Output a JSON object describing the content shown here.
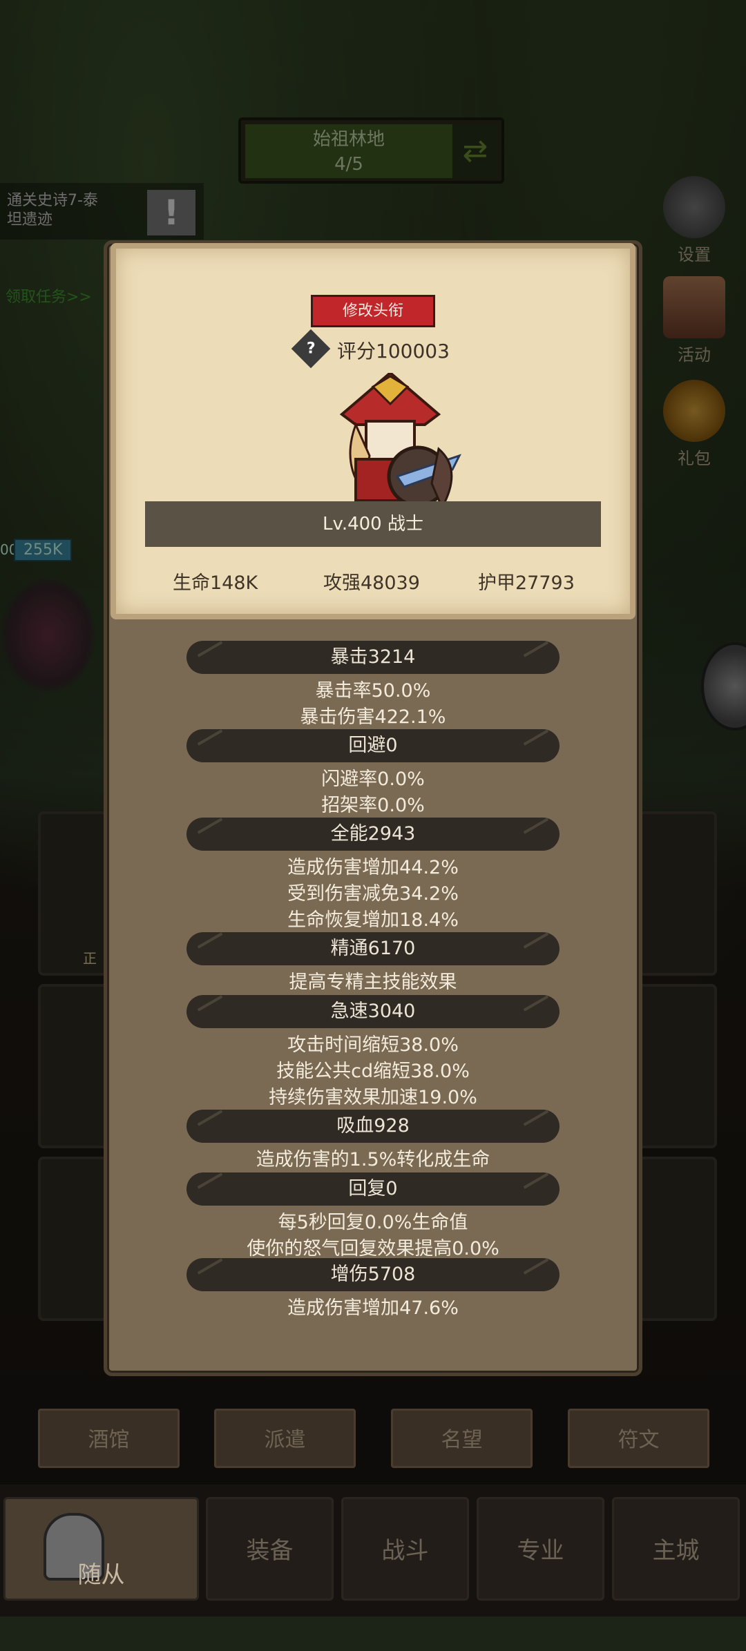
{
  "map": {
    "name": "始祖林地",
    "progress": "4/5"
  },
  "quest": {
    "text_line1": "通关史诗7-泰",
    "text_line2": "坦遗迹",
    "claim_link": "领取任务>>"
  },
  "side_buttons": {
    "settings": "设置",
    "events": "活动",
    "gift": "礼包"
  },
  "left_hp": "255K",
  "left_num": "00",
  "hero_slot_labels": {
    "status": "正"
  },
  "mid_tabs": [
    "酒馆",
    "派遣",
    "名望",
    "符文"
  ],
  "bottom_nav": [
    "随从",
    "装备",
    "战斗",
    "专业",
    "主城"
  ],
  "profile": {
    "edit_title_button": "修改头衔",
    "help_symbol": "?",
    "score": "评分100003",
    "level_class": "Lv.400 战士",
    "hp": "生命148K",
    "attack": "攻强48039",
    "armor": "护甲27793"
  },
  "stats": [
    {
      "header": "暴击3214",
      "lines": [
        "暴击率50.0%",
        "暴击伤害422.1%"
      ]
    },
    {
      "header": "回避0",
      "lines": [
        "闪避率0.0%",
        "招架率0.0%"
      ]
    },
    {
      "header": "全能2943",
      "lines": [
        "造成伤害增加44.2%",
        "受到伤害减免34.2%",
        "生命恢复增加18.4%"
      ]
    },
    {
      "header": "精通6170",
      "lines": [
        "提高专精主技能效果"
      ]
    },
    {
      "header": "急速3040",
      "lines": [
        "攻击时间缩短38.0%",
        "技能公共cd缩短38.0%",
        "持续伤害效果加速19.0%"
      ]
    },
    {
      "header": "吸血928",
      "lines": [
        "造成伤害的1.5%转化成生命"
      ]
    },
    {
      "header": "回复0",
      "lines": [
        "每5秒回复0.0%生命值",
        "使你的怒气回复效果提高0.0%"
      ]
    },
    {
      "header": "增伤5708",
      "lines": [
        "造成伤害增加47.6%"
      ]
    }
  ],
  "colors": {
    "accent_red": "#c0262a",
    "card_bg": "#ecdcb7",
    "panel_bg": "#7b6a53",
    "stat_header_bg": "#2f2a24"
  }
}
